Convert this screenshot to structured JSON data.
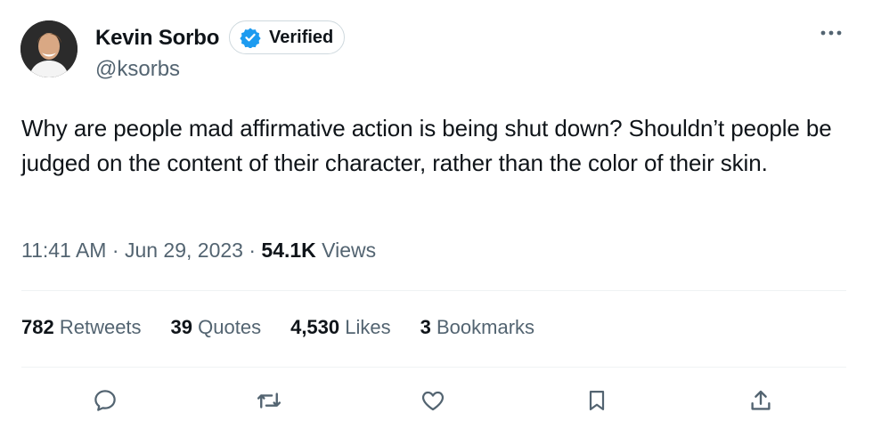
{
  "author": {
    "name": "Kevin Sorbo",
    "badge_label": "Verified",
    "handle": "@ksorbs",
    "avatar_icon": "profile-photo"
  },
  "tweet": {
    "text": "Why are people mad affirmative action is being shut down? Shouldn’t people be judged on the content of their character, rather than the color of their skin.",
    "time": "11:41 AM",
    "separator1": " · ",
    "date": "Jun 29, 2023",
    "separator2": " · ",
    "views_count": "54.1K",
    "views_label": " Views"
  },
  "stats": [
    {
      "count": "782",
      "label": " Retweets"
    },
    {
      "count": "39",
      "label": " Quotes"
    },
    {
      "count": "4,530",
      "label": " Likes"
    },
    {
      "count": "3",
      "label": " Bookmarks"
    }
  ],
  "actions": [
    "reply-icon",
    "retweet-icon",
    "like-icon",
    "bookmark-icon",
    "share-icon"
  ],
  "colors": {
    "text": "#0f1419",
    "secondary": "#536471",
    "verified_blue": "#1d9bf0",
    "divider": "#eff3f4"
  }
}
